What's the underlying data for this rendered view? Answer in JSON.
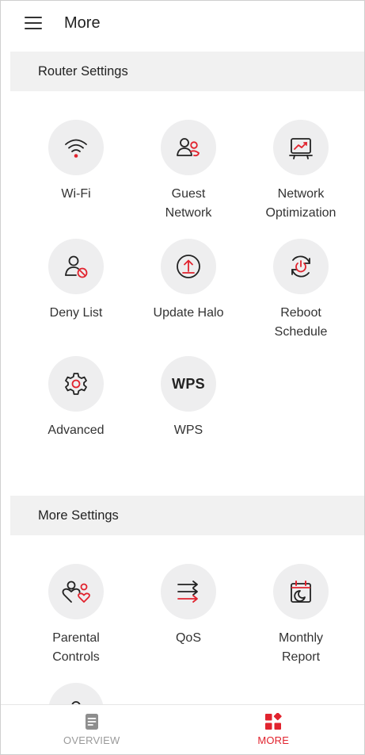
{
  "header": {
    "title": "More"
  },
  "sections": [
    {
      "title": "Router Settings",
      "items": [
        {
          "label": "Wi-Fi",
          "icon": "wifi-icon"
        },
        {
          "label": "Guest\nNetwork",
          "icon": "guest-network-icon"
        },
        {
          "label": "Network\nOptimization",
          "icon": "network-optimization-icon"
        },
        {
          "label": "Deny List",
          "icon": "deny-list-icon"
        },
        {
          "label": "Update Halo",
          "icon": "update-icon"
        },
        {
          "label": "Reboot\nSchedule",
          "icon": "reboot-schedule-icon"
        },
        {
          "label": "Advanced",
          "icon": "gear-icon"
        },
        {
          "label": "WPS",
          "icon": "wps-icon",
          "icon_text": "WPS"
        }
      ]
    },
    {
      "title": "More Settings",
      "items": [
        {
          "label": "Parental\nControls",
          "icon": "parental-controls-icon"
        },
        {
          "label": "QoS",
          "icon": "qos-icon"
        },
        {
          "label": "Monthly\nReport",
          "icon": "monthly-report-icon"
        },
        {
          "label": "",
          "icon": "user-icon"
        }
      ]
    }
  ],
  "bottom_nav": {
    "tabs": [
      {
        "label": "OVERVIEW",
        "icon": "document-icon",
        "active": false
      },
      {
        "label": "MORE",
        "icon": "more-grid-icon",
        "active": true
      }
    ]
  },
  "colors": {
    "accent": "#e1232e",
    "icon_bg": "#eeeeef",
    "section_bg": "#f1f1f1",
    "text": "#222222",
    "inactive": "#9a9a9a"
  }
}
